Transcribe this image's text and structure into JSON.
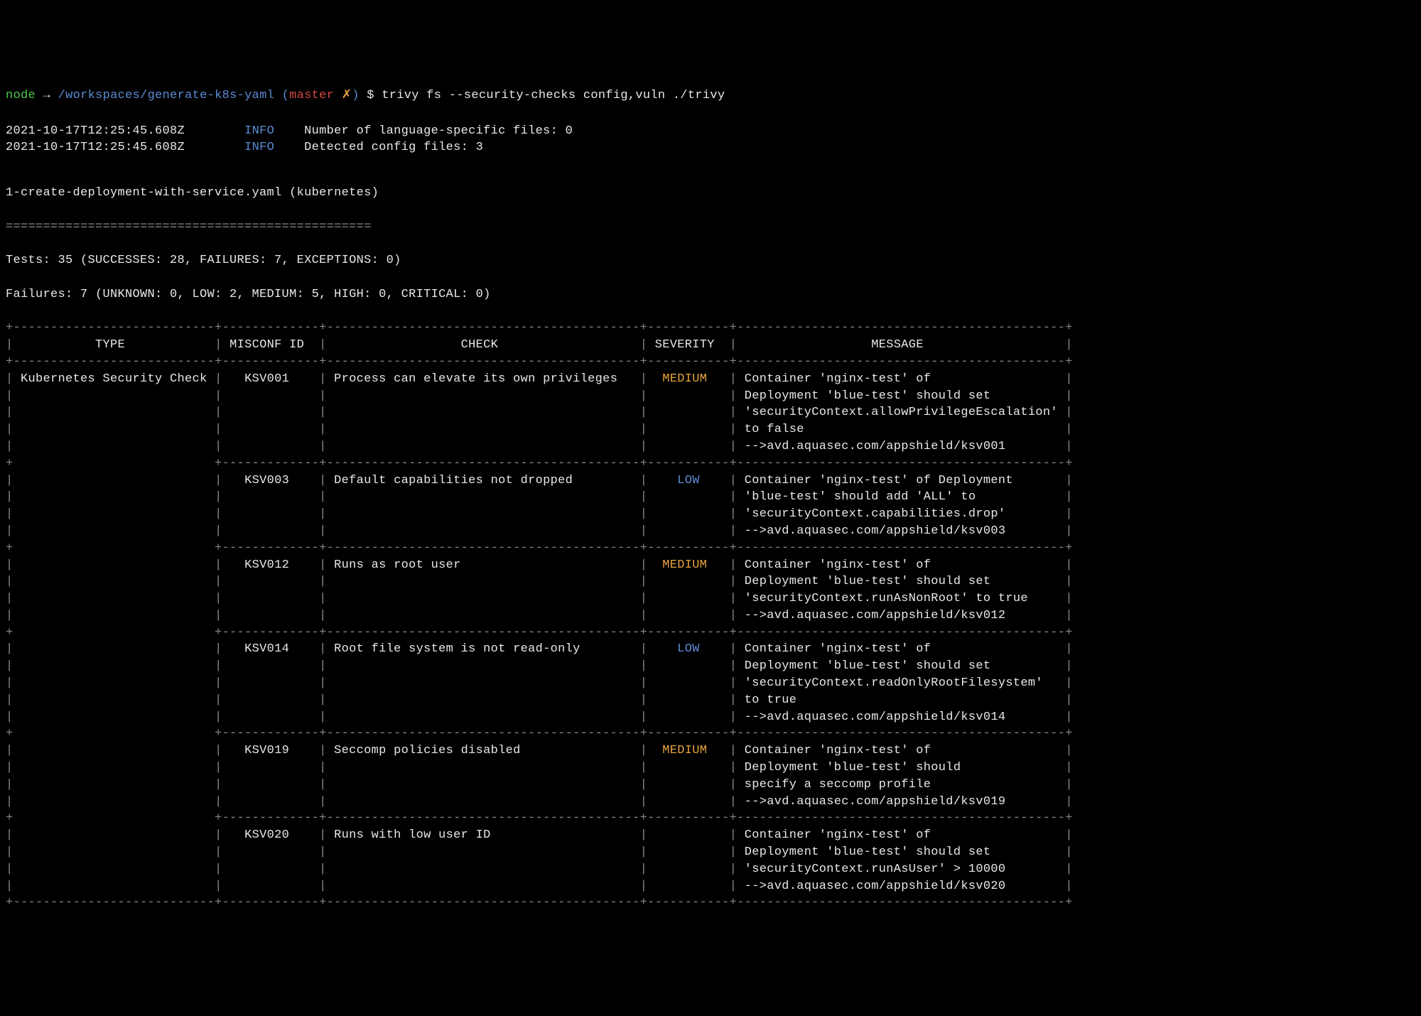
{
  "prompt": {
    "user": "node",
    "arrow": "→",
    "cwd": "/workspaces/generate-k8s-yaml",
    "branch_open": "(",
    "branch": "master",
    "dirty": "✗",
    "branch_close": ")",
    "dollar": "$",
    "command": "trivy fs --security-checks config,vuln ./trivy"
  },
  "log_lines": [
    {
      "ts": "2021-10-17T12:25:45.608Z",
      "level": "INFO",
      "msg": "Number of language-specific files: 0"
    },
    {
      "ts": "2021-10-17T12:25:45.608Z",
      "level": "INFO",
      "msg": "Detected config files: 3"
    }
  ],
  "file_header": "1-create-deployment-with-service.yaml (kubernetes)",
  "divider_line": "=================================================",
  "tests_line": "Tests: 35 (SUCCESSES: 28, FAILURES: 7, EXCEPTIONS: 0)",
  "failures_line": "Failures: 7 (UNKNOWN: 0, LOW: 2, MEDIUM: 5, HIGH: 0, CRITICAL: 0)",
  "table": {
    "headers": {
      "type": "TYPE",
      "misconf_id": "MISCONF ID",
      "check": "CHECK",
      "severity": "SEVERITY",
      "message": "MESSAGE"
    },
    "rows": [
      {
        "type": "Kubernetes Security Check",
        "misconf_id": "KSV001",
        "check": "Process can elevate its own privileges",
        "severity": "MEDIUM",
        "message": [
          "Container 'nginx-test' of",
          "Deployment 'blue-test' should set",
          "'securityContext.allowPrivilegeEscalation'",
          "to false",
          "-->avd.aquasec.com/appshield/ksv001"
        ]
      },
      {
        "type": "",
        "misconf_id": "KSV003",
        "check": "Default capabilities not dropped",
        "severity": "LOW",
        "message": [
          "Container 'nginx-test' of Deployment",
          "'blue-test' should add 'ALL' to",
          "'securityContext.capabilities.drop'",
          "-->avd.aquasec.com/appshield/ksv003"
        ]
      },
      {
        "type": "",
        "misconf_id": "KSV012",
        "check": "Runs as root user",
        "severity": "MEDIUM",
        "message": [
          "Container 'nginx-test' of",
          "Deployment 'blue-test' should set",
          "'securityContext.runAsNonRoot' to true",
          "-->avd.aquasec.com/appshield/ksv012"
        ]
      },
      {
        "type": "",
        "misconf_id": "KSV014",
        "check": "Root file system is not read-only",
        "severity": "LOW",
        "message": [
          "Container 'nginx-test' of",
          "Deployment 'blue-test' should set",
          "'securityContext.readOnlyRootFilesystem'",
          "to true",
          "-->avd.aquasec.com/appshield/ksv014"
        ]
      },
      {
        "type": "",
        "misconf_id": "KSV019",
        "check": "Seccomp policies disabled",
        "severity": "MEDIUM",
        "message": [
          "Container 'nginx-test' of",
          "Deployment 'blue-test' should",
          "specify a seccomp profile",
          "-->avd.aquasec.com/appshield/ksv019"
        ]
      },
      {
        "type": "",
        "misconf_id": "KSV020",
        "check": "Runs with low user ID",
        "severity": "",
        "message": [
          "Container 'nginx-test' of",
          "Deployment 'blue-test' should set",
          "'securityContext.runAsUser' > 10000",
          "-->avd.aquasec.com/appshield/ksv020"
        ]
      }
    ]
  }
}
